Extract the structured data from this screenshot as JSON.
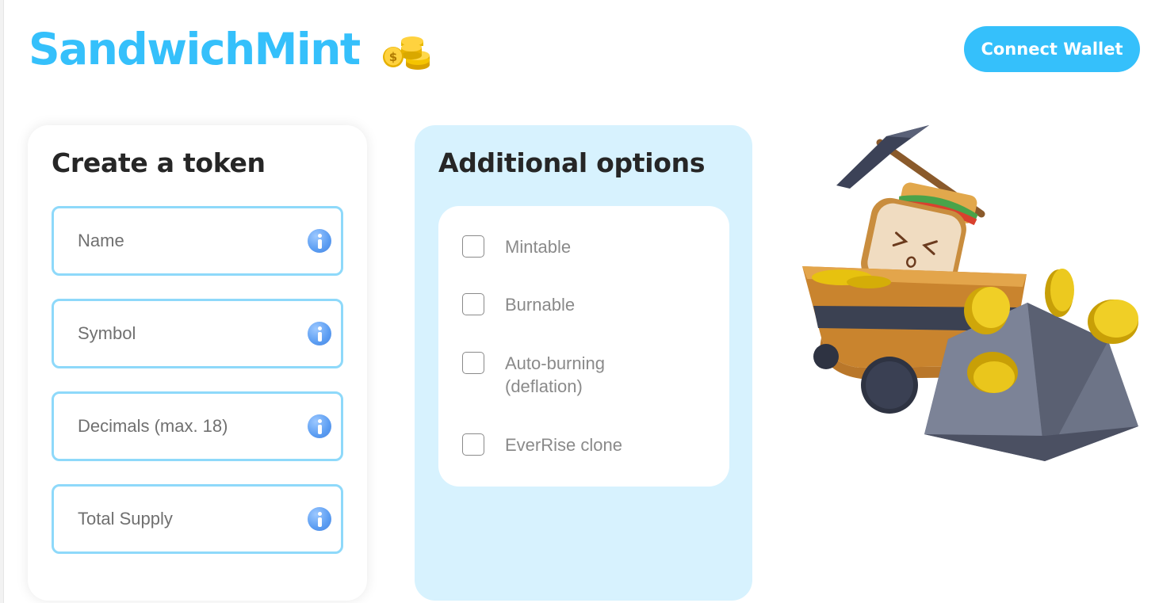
{
  "header": {
    "logo_text": "SandwichMint",
    "logo_icon": "money-coins-icon",
    "connect_wallet_label": "Connect Wallet"
  },
  "create_token": {
    "title": "Create a token",
    "fields": [
      {
        "label": "Name",
        "icon": "info-icon"
      },
      {
        "label": "Symbol",
        "icon": "info-icon"
      },
      {
        "label": "Decimals (max. 18)",
        "icon": "info-icon"
      },
      {
        "label": "Total Supply",
        "icon": "info-icon"
      }
    ]
  },
  "additional_options": {
    "title": "Additional options",
    "options": [
      {
        "label": "Mintable",
        "checked": false
      },
      {
        "label": "Burnable",
        "checked": false
      },
      {
        "label": "Auto-burning (deflation)",
        "checked": false
      },
      {
        "label": "EverRise clone",
        "checked": false
      }
    ]
  },
  "illustration": {
    "icon": "sandwich-mine-cart-illustration"
  },
  "colors": {
    "accent": "#35c0fb",
    "field_border": "#8ed9fa",
    "options_panel": "#d7f2fe",
    "heading": "#262626"
  }
}
